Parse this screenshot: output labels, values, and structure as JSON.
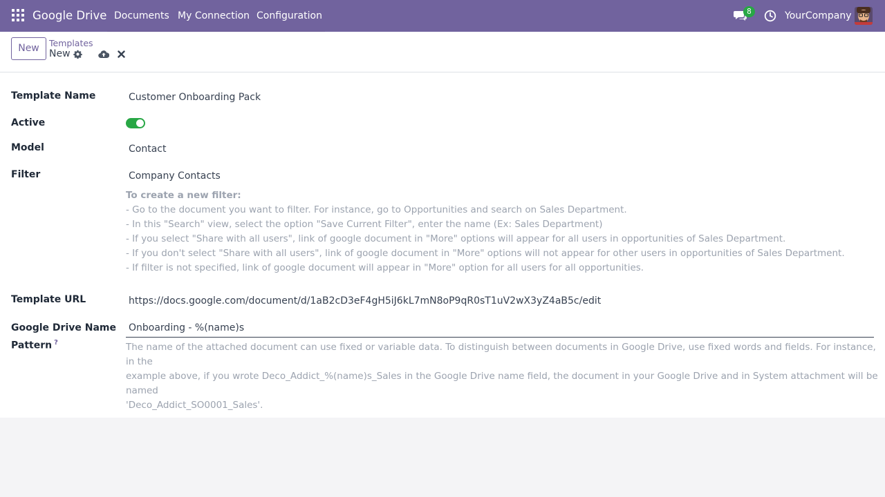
{
  "navbar": {
    "brand": "Google Drive",
    "menu": [
      "Documents",
      "My Connection",
      "Configuration"
    ],
    "chat_count": "8",
    "company": "YourCompany"
  },
  "control": {
    "new_label": "New",
    "breadcrumb_parent": "Templates",
    "breadcrumb_current": "New"
  },
  "form": {
    "template_name": {
      "label": "Template Name",
      "value": "Customer Onboarding Pack"
    },
    "active": {
      "label": "Active",
      "value": true
    },
    "model": {
      "label": "Model",
      "value": "Contact"
    },
    "filter": {
      "label": "Filter",
      "value": "Company Contacts",
      "help_title": "To create a new filter:",
      "help_lines": [
        "- Go to the document you want to filter. For instance, go to Opportunities and search on Sales Department.",
        "- In this \"Search\" view, select the option \"Save Current Filter\", enter the name (Ex: Sales Department)",
        "- If you select \"Share with all users\", link of google document in \"More\" options will appear for all users in opportunities of Sales Department.",
        "- If you don't select \"Share with all users\", link of google document in \"More\" options will not appear for other users in opportunities of Sales Department.",
        "- If filter is not specified, link of google document will appear in \"More\" option for all users for all opportunities."
      ]
    },
    "template_url": {
      "label": "Template URL",
      "value": "https://docs.google.com/document/d/1aB2cD3eF4gH5iJ6kL7mN8oP9qR0sT1uV2wX3yZ4aB5c/edit"
    },
    "name_pattern": {
      "label_line1": "Google Drive Name",
      "label_line2": "Pattern",
      "tooltip_mark": "?",
      "value": "Onboarding - %(name)s",
      "help_lines": [
        "The name of the attached document can use fixed or variable data. To distinguish between documents in Google Drive, use fixed words and fields. For instance, in the",
        "example above, if you wrote Deco_Addict_%(name)s_Sales in the Google Drive name field, the document in your Google Drive and in System attachment will be named",
        "'Deco_Addict_SO0001_Sales'."
      ]
    }
  },
  "colors": {
    "navbar": "#71639e",
    "toggle_on": "#28a745",
    "badge": "#28a745"
  }
}
